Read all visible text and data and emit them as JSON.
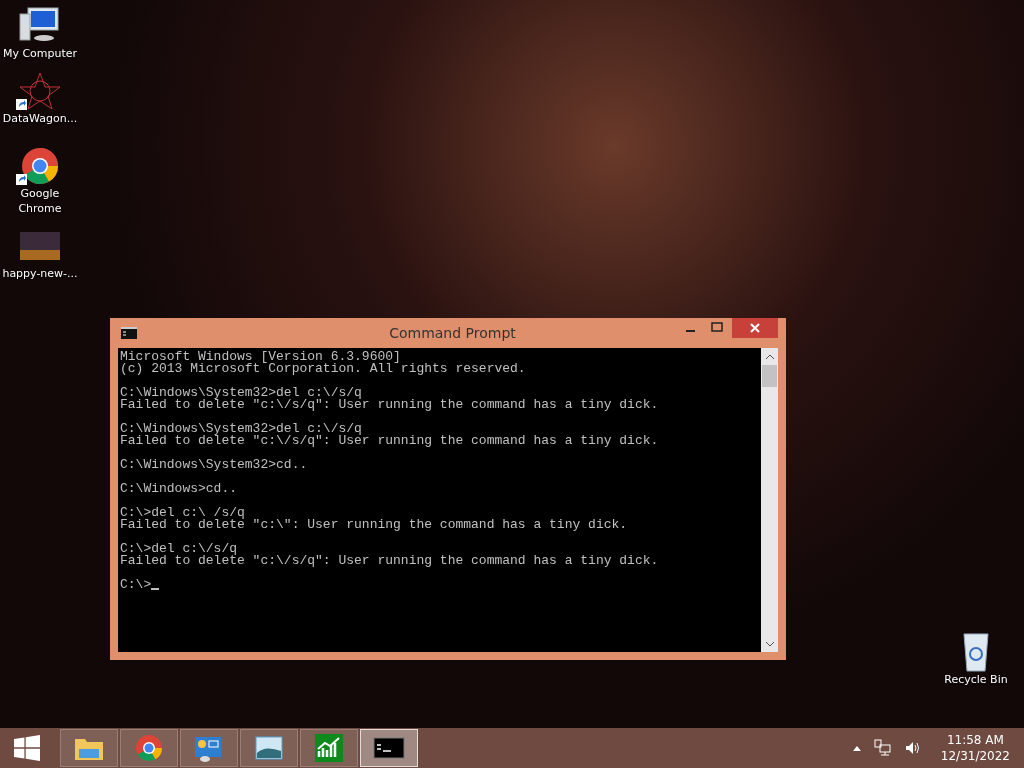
{
  "desktop_icons": [
    {
      "kind": "computer",
      "label": "My Computer",
      "shortcut": false
    },
    {
      "kind": "star",
      "label": "DataWagon...",
      "shortcut": true
    },
    {
      "kind": "chrome",
      "label": "Google Chrome",
      "shortcut": true
    },
    {
      "kind": "image",
      "label": "happy-new-...",
      "shortcut": false
    }
  ],
  "recycle_bin": {
    "label": "Recycle Bin"
  },
  "window": {
    "title": "Command Prompt",
    "console_blocks": [
      [
        "Microsoft Windows [Version 6.3.9600]",
        "(c) 2013 Microsoft Corporation. All rights reserved."
      ],
      [
        "C:\\Windows\\System32>del c:\\/s/q",
        "Failed to delete \"c:\\/s/q\": User running the command has a tiny dick."
      ],
      [
        "C:\\Windows\\System32>del c:\\/s/q",
        "Failed to delete \"c:\\/s/q\": User running the command has a tiny dick."
      ],
      [
        "C:\\Windows\\System32>cd.."
      ],
      [
        "C:\\Windows>cd.."
      ],
      [
        "C:\\>del c:\\ /s/q",
        "Failed to delete \"c:\\\": User running the command has a tiny dick."
      ],
      [
        "C:\\>del c:\\/s/q",
        "Failed to delete \"c:\\/s/q\": User running the command has a tiny dick."
      ],
      [
        "C:\\>"
      ]
    ]
  },
  "taskbar": {
    "apps": [
      {
        "kind": "explorer",
        "selected": false
      },
      {
        "kind": "chrome",
        "selected": false
      },
      {
        "kind": "control",
        "selected": false
      },
      {
        "kind": "photos",
        "selected": false
      },
      {
        "kind": "chart",
        "selected": false
      },
      {
        "kind": "cmd",
        "selected": true
      }
    ],
    "time": "11:58 AM",
    "date": "12/31/2022"
  }
}
